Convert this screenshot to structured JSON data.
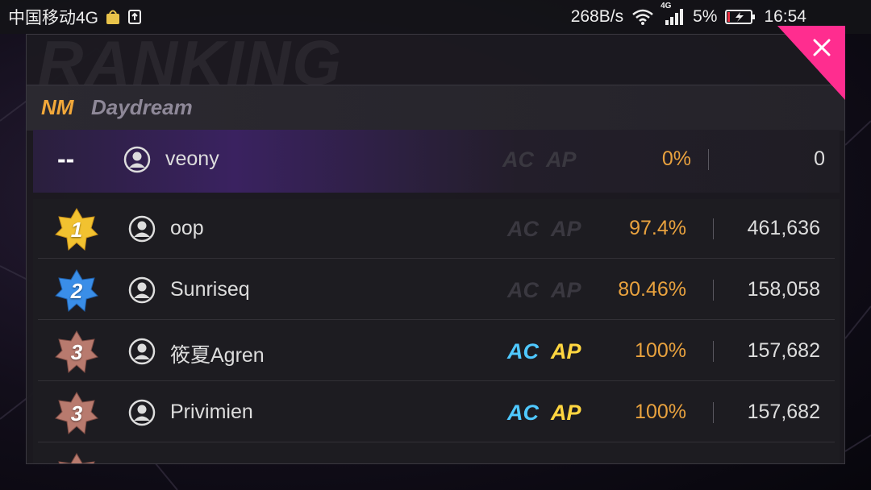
{
  "status_bar": {
    "carrier": "中国移动4G",
    "net_speed": "268B/s",
    "network_label": "4G",
    "battery": "5%",
    "time": "16:54"
  },
  "panel": {
    "title": "RANKING",
    "difficulty": "NM",
    "song": "Daydream"
  },
  "me": {
    "rank": "--",
    "name": "veony",
    "ac": "AC",
    "ap": "AP",
    "accuracy": "0%",
    "score": "0"
  },
  "rows": [
    {
      "rank": "1",
      "name": "oop",
      "ac": "AC",
      "ap": "AP",
      "accuracy": "97.4%",
      "score": "461,636",
      "ac_active": false,
      "ap_active": false,
      "badge_color": "#f2c230"
    },
    {
      "rank": "2",
      "name": "Sunriseq",
      "ac": "AC",
      "ap": "AP",
      "accuracy": "80.46%",
      "score": "158,058",
      "ac_active": false,
      "ap_active": false,
      "badge_color": "#3a8ee8"
    },
    {
      "rank": "3",
      "name": "筱夏Agren",
      "ac": "AC",
      "ap": "AP",
      "accuracy": "100%",
      "score": "157,682",
      "ac_active": true,
      "ap_active": true,
      "badge_color": "#b87a6e"
    },
    {
      "rank": "3",
      "name": "Privimien",
      "ac": "AC",
      "ap": "AP",
      "accuracy": "100%",
      "score": "157,682",
      "ac_active": true,
      "ap_active": true,
      "badge_color": "#b87a6e"
    }
  ],
  "colors": {
    "accent": "#f2a83a",
    "close": "#ff2d8f",
    "ac_on": "#4fc8ff",
    "ap_on": "#ffd640"
  }
}
